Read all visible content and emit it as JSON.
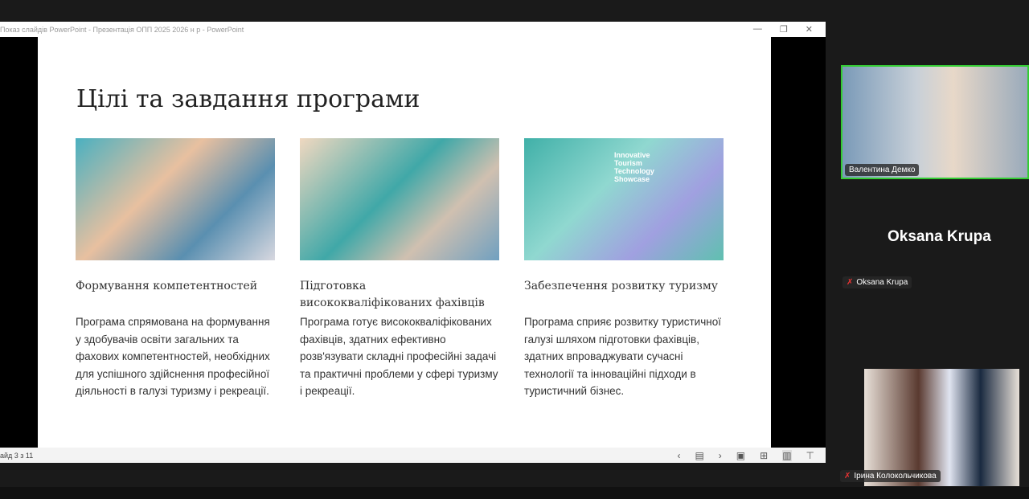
{
  "window": {
    "title": "Показ слайдів PowerPoint  -  Презентація ОПП 2025 2026 н р - PowerPoint",
    "controls": [
      "—",
      "❐",
      "✕"
    ]
  },
  "slide": {
    "title": "Цілі та завдання програми",
    "columns": [
      {
        "heading": "Формування компетентностей",
        "body": "Програма спрямована на формування у здобувачів освіти загальних та фахових компетентностей, необхідних для успішного здійснення професійної діяльності в галузі туризму і рекреації."
      },
      {
        "heading": "Підготовка висококваліфікованих фахівців",
        "body": "Програма готує висококваліфікованих фахівців, здатних ефективно розв'язувати складні професійні задачі та практичні проблеми у сфері туризму і рекреації."
      },
      {
        "heading": "Забезпечення розвитку туризму",
        "body": "Програма сприяє розвитку туристичної галузі шляхом підготовки фахівців, здатних впроваджувати сучасні технології та інноваційні підходи в туристичний бізнес."
      }
    ],
    "image3_text": "Innovative Tourism Technology Showcase"
  },
  "status": {
    "slide_counter": "айд 3 з 11",
    "nav": [
      "‹",
      "▤",
      "›",
      "▣",
      "⊞",
      "▥",
      "⊤"
    ]
  },
  "participants": [
    {
      "name": "Валентина Демко"
    },
    {
      "name": "Oksana Krupa"
    },
    {
      "name": "Ірина Колокольчикова"
    }
  ]
}
